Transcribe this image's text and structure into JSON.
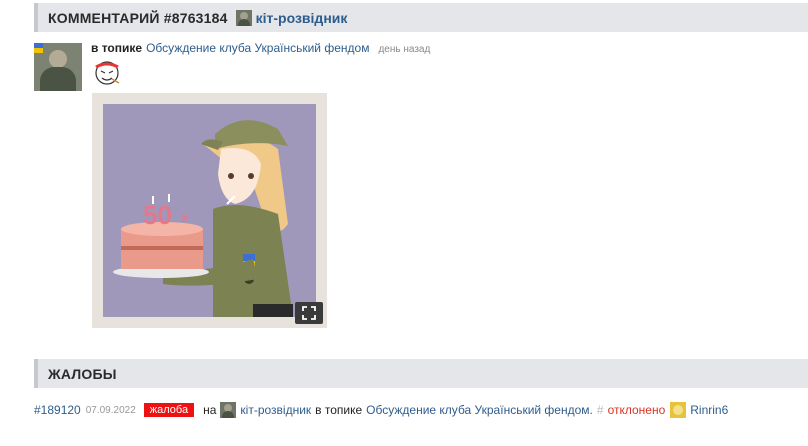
{
  "comment_section": {
    "title": "КОММЕНТАРИЙ #8763184",
    "author": "кіт-розвідник"
  },
  "comment": {
    "prefix": "в топике",
    "topic": "Обсуждение клуба Український фендом",
    "time": "день назад",
    "avatar_icon": "soldier-cat-avatar-icon",
    "expand_icon": "expand-icon"
  },
  "complaints_section": {
    "title": "ЖАЛОБЫ"
  },
  "complaint": {
    "id": "#189120",
    "date": "07.09.2022",
    "badge": "жалоба",
    "on": "на",
    "user": "кіт-розвідник",
    "in_topic": "в топике",
    "topic": "Обсуждение клуба Український фендом.",
    "hash": "#",
    "status": "отклонено",
    "moderator": "Rinrin6",
    "badge_color": "#ee1111",
    "status_color": "#dd3322"
  }
}
